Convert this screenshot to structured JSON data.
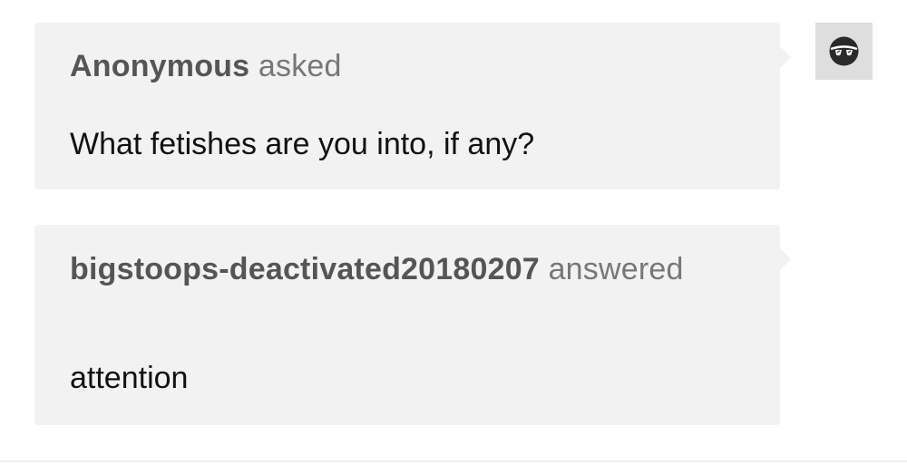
{
  "question": {
    "asker": "Anonymous",
    "verb": "asked",
    "text": "What fetishes are you into, if any?"
  },
  "answer": {
    "answerer": "bigstoops-deactivated20180207",
    "verb": "answered",
    "text": "attention"
  },
  "avatar": {
    "icon": "sunglasses-avatar-icon"
  },
  "colors": {
    "bubble": "#f2f2f2",
    "header_text": "#555555",
    "body_text": "#111111"
  }
}
